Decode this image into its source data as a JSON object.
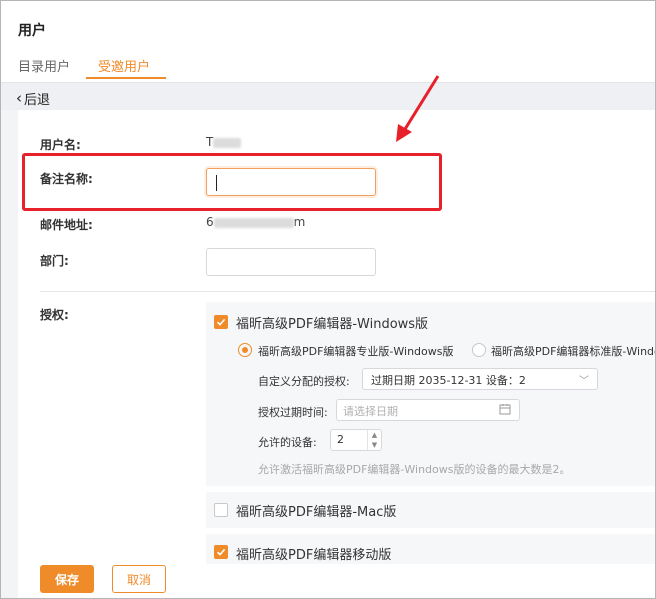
{
  "page": {
    "title": "用户"
  },
  "tabs": [
    {
      "label": "目录用户",
      "active": false
    },
    {
      "label": "受邀用户",
      "active": true
    }
  ],
  "back": {
    "label": "后退"
  },
  "form": {
    "username": {
      "label": "用户名:",
      "value": "T"
    },
    "remark": {
      "label": "备注名称:",
      "value": ""
    },
    "email": {
      "label": "邮件地址:",
      "value_prefix": "6",
      "value_suffix": "m"
    },
    "department": {
      "label": "部门:",
      "value": ""
    },
    "auth": {
      "label": "授权:"
    }
  },
  "products": [
    {
      "name": "福昕高级PDF编辑器-Windows版",
      "checked": true,
      "editions": [
        {
          "label": "福昕高级PDF编辑器专业版-Windows版",
          "selected": true
        },
        {
          "label": "福昕高级PDF编辑器标准版-Windo",
          "selected": false
        }
      ],
      "custom_license": {
        "label": "自定义分配的授权:",
        "value": "过期日期 2035-12-31 设备：2"
      },
      "expiry": {
        "label": "授权过期时间:",
        "placeholder": "请选择日期"
      },
      "devices": {
        "label": "允许的设备:",
        "value": "2"
      },
      "hint": "允许激活福昕高级PDF编辑器-Windows版的设备的最大数是2。"
    },
    {
      "name": "福昕高级PDF编辑器-Mac版",
      "checked": false
    },
    {
      "name": "福昕高级PDF编辑器移动版",
      "checked": true
    }
  ],
  "buttons": {
    "save": "保存",
    "cancel": "取消"
  },
  "colors": {
    "accent": "#f08b2a",
    "annotation": "#e8202a"
  }
}
